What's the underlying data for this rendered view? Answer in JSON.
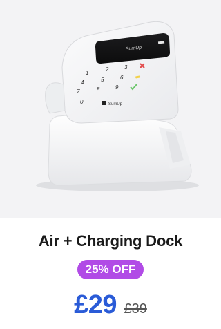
{
  "product": {
    "device_screen_text": "SumUp",
    "device_keypad": [
      "1",
      "2",
      "3",
      "4",
      "5",
      "6",
      "7",
      "8",
      "9",
      "0"
    ],
    "device_brand_text": "SumUp",
    "title": "Air + Charging Dock",
    "badge": "25% OFF",
    "price": "£29",
    "old_price": "£39"
  },
  "colors": {
    "background": "#f3f3f5",
    "badge": "#b14be6",
    "price": "#2a5bd7"
  }
}
